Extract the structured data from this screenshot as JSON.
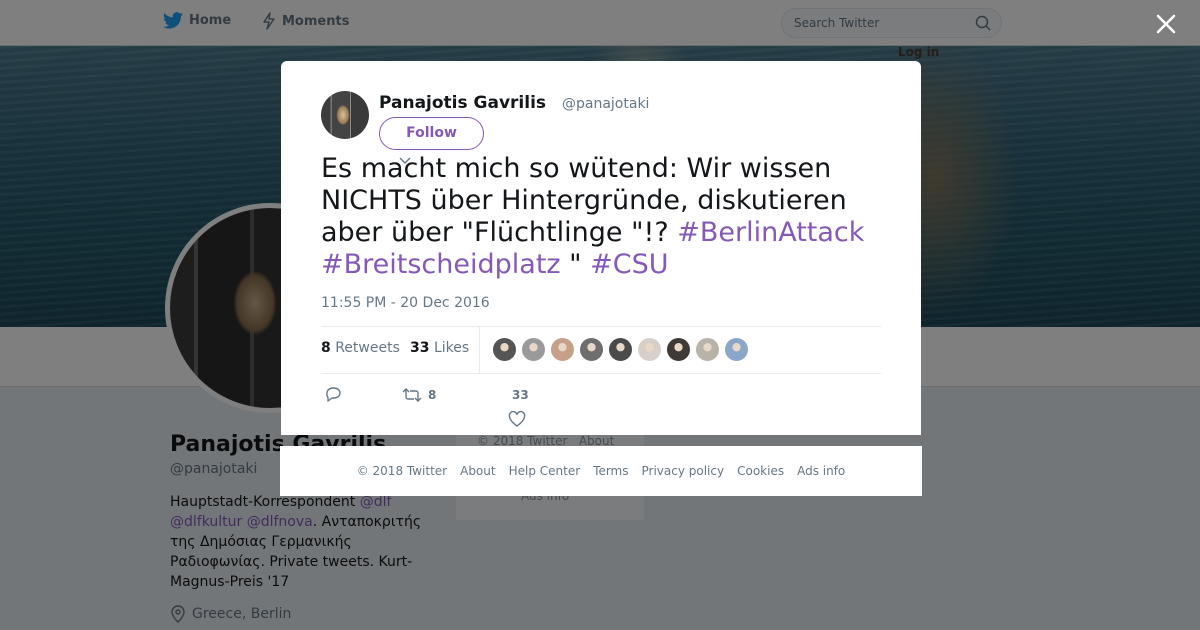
{
  "nav": {
    "home_label": "Home",
    "moments_label": "Moments",
    "search_placeholder": "Search Twitter",
    "login_label": "Log in"
  },
  "profile": {
    "name": "Panajotis Gavrilis",
    "handle": "@panajotaki",
    "bio": {
      "prefix": "Hauptstadt-Korrespondent ",
      "mention1": "@dlf",
      "mention2": "@dlfkultur",
      "mention3": "@dlfnova",
      "suffix": ". Ανταποκριτής της Δημόσιας Γερμανικής Ραδιοφωνίας. Private tweets. Kurt-Magnus-Preis '17"
    },
    "location": "Greece, Berlin"
  },
  "side_footer": {
    "copyright": "© 2018 Twitter",
    "about": "About",
    "ads_info": "Ads info"
  },
  "tweet": {
    "author_name": "Panajotis Gavrilis",
    "author_handle": "@panajotaki",
    "follow_label": "Follow",
    "text_part1": "Es macht mich so wütend: Wir wissen NICHTS über Hintergründe, diskutieren aber über \"Flüchtlinge \"!? ",
    "hashtag1": "#BerlinAttack",
    "hashtag2": "#Breitscheidplatz",
    "text_part2": " \" ",
    "hashtag3": "#CSU",
    "timestamp": "11:55 PM - 20 Dec 2016",
    "retweets_count": "8",
    "retweets_label": "Retweets",
    "likes_count": "33",
    "likes_label": "Likes",
    "action_retweet_count": "8",
    "action_like_count": "33",
    "likers": [
      "#555555",
      "#9a9a9a",
      "#c7a089",
      "#6e6e6e",
      "#4b4b4b",
      "#d8d0c8",
      "#3f3a36",
      "#b8b2a8",
      "#8aa6c8"
    ]
  },
  "footer": {
    "items": [
      "© 2018 Twitter",
      "About",
      "Help Center",
      "Terms",
      "Privacy policy",
      "Cookies",
      "Ads info"
    ]
  }
}
